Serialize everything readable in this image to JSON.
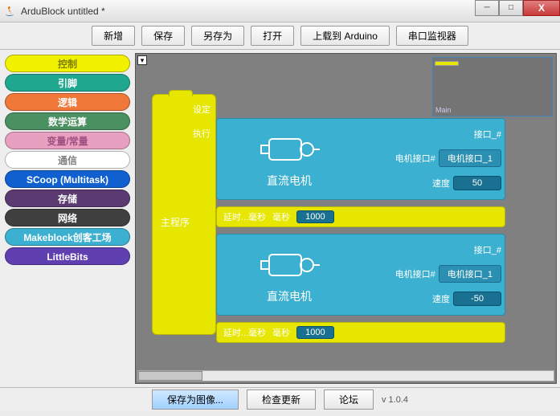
{
  "window": {
    "title": "ArduBlock untitled *",
    "minimap_label": "Main"
  },
  "toolbar": {
    "new": "新增",
    "save": "保存",
    "saveas": "另存为",
    "open": "打开",
    "upload": "上载到 Arduino",
    "serial": "串口监视器"
  },
  "palette": [
    {
      "label": "控制",
      "bg": "#f2f200",
      "fg": "#808000"
    },
    {
      "label": "引脚",
      "bg": "#1fa88f",
      "fg": "#ffffff"
    },
    {
      "label": "逻辑",
      "bg": "#f07838",
      "fg": "#ffffff"
    },
    {
      "label": "数学运算",
      "bg": "#4a9060",
      "fg": "#ffffff"
    },
    {
      "label": "变量/常量",
      "bg": "#e8a0c0",
      "fg": "#a05080"
    },
    {
      "label": "通信",
      "bg": "#ffffff",
      "fg": "#808080"
    },
    {
      "label": "SCoop (Multitask)",
      "bg": "#1060d0",
      "fg": "#ffffff"
    },
    {
      "label": "存储",
      "bg": "#5a3a70",
      "fg": "#ffffff"
    },
    {
      "label": "网络",
      "bg": "#404040",
      "fg": "#ffffff"
    },
    {
      "label": "Makeblock创客工场",
      "bg": "#3cb0d0",
      "fg": "#ffffff"
    },
    {
      "label": "LittleBits",
      "bg": "#6040b0",
      "fg": "#ffffff"
    }
  ],
  "blocks": {
    "main_label": "主程序",
    "setup_label": "设定",
    "exec_label": "执行",
    "motor_name": "直流电机",
    "param_port": "接口_#",
    "param_motorport": "电机接口#",
    "param_speed": "速度",
    "port_value": "电机接口_1",
    "speed1": "50",
    "speed2": "-50",
    "delay_label": "延时...毫秒",
    "delay_unit": "毫秒",
    "delay_value": "1000"
  },
  "status": {
    "saveimg": "保存为图像...",
    "checkupdate": "检查更新",
    "forum": "论坛",
    "version": "v 1.0.4"
  }
}
